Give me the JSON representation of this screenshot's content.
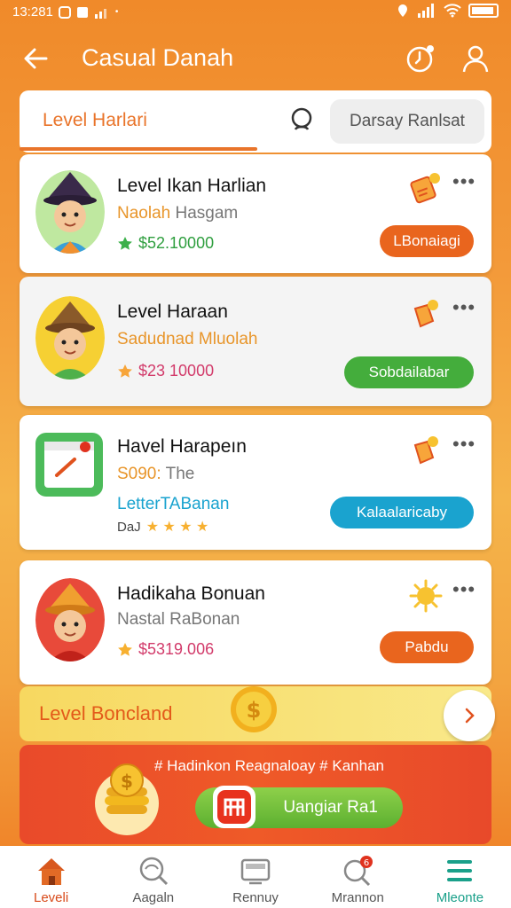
{
  "status": {
    "time": "13:281"
  },
  "app_bar": {
    "title": "Casual Danah"
  },
  "tabs": {
    "active_label": "Level Harlari",
    "daily_button": "Darsay Ranlsat"
  },
  "cards": [
    {
      "title": "Level Ikan Harlian",
      "subtitle_a": "Naolah",
      "subtitle_b": "Hasgam",
      "price": "$52.10000",
      "button": "LBonaiagi",
      "button_color": "#e9651e"
    },
    {
      "title": "Level Haraan",
      "subtitle": "Sadudnad Mluolah",
      "price": "$23 10000",
      "button": "Sobdailabar",
      "button_color": "#44ad3c"
    },
    {
      "title": "Havel Harapeın",
      "subtitle_a": "S090:",
      "subtitle_b": "The",
      "extra": "LetterTABanan",
      "rating_label": "DaJ",
      "button": "Kalaalaricaby",
      "button_color": "#1aa3cf"
    },
    {
      "title": "Hadikaha Bonuan",
      "subtitle": "Nastal RaBonan",
      "price": "$5319.006",
      "button": "Pabdu",
      "button_color": "#e9651e"
    }
  ],
  "bonus_bar": {
    "label": "Level Boncland"
  },
  "promo": {
    "text": "# Hadinkon Reagnaloay # Kanhan",
    "button": "Uangiar Ra1"
  },
  "nav": [
    {
      "label": "Leveli"
    },
    {
      "label": "Aagaln"
    },
    {
      "label": "Rennuy"
    },
    {
      "label": "Mrannon",
      "badge": "6"
    },
    {
      "label": "Mleonte"
    }
  ]
}
